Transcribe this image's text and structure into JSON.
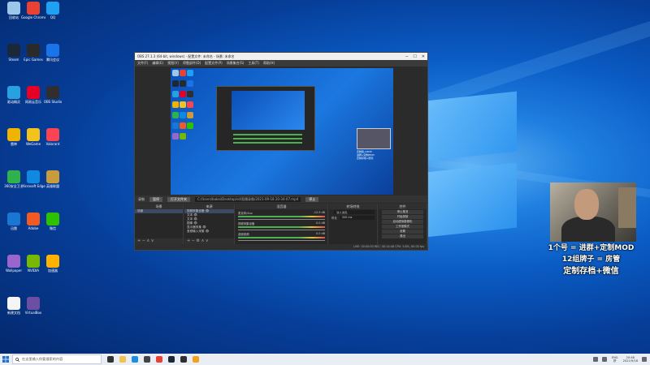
{
  "desktop_icons": [
    {
      "label": "回收站",
      "color": "#9cc7e8"
    },
    {
      "label": "Google Chrome",
      "color": "#e94235"
    },
    {
      "label": "QQ",
      "color": "#1ea1f2"
    },
    {
      "label": "Steam",
      "color": "#1b2838"
    },
    {
      "label": "Epic Games",
      "color": "#2a2a2a"
    },
    {
      "label": "腾讯会议",
      "color": "#1a73e8"
    },
    {
      "label": "驱动精灵",
      "color": "#27a1e0"
    },
    {
      "label": "网易云音乐",
      "color": "#e60026"
    },
    {
      "label": "OBS Studio",
      "color": "#302e31"
    },
    {
      "label": "雷神",
      "color": "#f0b400"
    },
    {
      "label": "WeGame",
      "color": "#f4c21c"
    },
    {
      "label": "Valorant",
      "color": "#fa4454"
    },
    {
      "label": "360安全卫士",
      "color": "#2fb24c"
    },
    {
      "label": "Microsoft Edge",
      "color": "#0f8ae0"
    },
    {
      "label": "英雄联盟",
      "color": "#c89b3c"
    },
    {
      "label": "迅雷",
      "color": "#1976d2"
    },
    {
      "label": "Adobe",
      "color": "#f15a24"
    },
    {
      "label": "微信",
      "color": "#2dc100"
    },
    {
      "label": "Wallpaper",
      "color": "#9966cc"
    },
    {
      "label": "NVIDIA",
      "color": "#76b900"
    },
    {
      "label": "加速器",
      "color": "#ffb300"
    },
    {
      "label": "新建文档",
      "color": "#f5f5f5"
    },
    {
      "label": "VirtualBox",
      "color": "#6c4fa3"
    }
  ],
  "obs": {
    "title": "OBS 27.1.3 (64-bit, windows) - 配置文件: 未命名 - 场景: 未命名",
    "menu": [
      "文件(F)",
      "编辑(E)",
      "视图(V)",
      "停靠部件(D)",
      "配置文件(P)",
      "场景集合(S)",
      "工具(T)",
      "帮助(H)"
    ],
    "recording_label": "录制",
    "pause_label": "暂停",
    "open_folder_label": "打开文件夹",
    "recording_path": "C:/Users/bakai/Desktop/sd/直播录像/2021-09-18 20-34-07.mp4",
    "stop_label": "停止",
    "scenes_header": "场景",
    "scenes": [
      "场景"
    ],
    "sources_header": "来源",
    "sources": [
      "视频采集设备",
      "文本",
      "文本",
      "图像",
      "显示器采集",
      "音频输入采集"
    ],
    "mixer_header": "混音器",
    "mixer_channels": [
      {
        "name": "麦克风/Aux",
        "db": "-12.9 dB"
      },
      {
        "name": "视频采集设备",
        "db": "0.0 dB"
      },
      {
        "name": "桌面音频",
        "db": "0.0 dB"
      }
    ],
    "transitions_header": "转场特效",
    "transition_type": "淡入淡出",
    "duration_label": "时长",
    "duration_value": "300 ms",
    "controls_header": "控件",
    "controls": [
      "停止推流",
      "开始录制",
      "启动虚拟摄像机",
      "工作室模式",
      "设置",
      "退出"
    ],
    "status": "LIVE: 00:00:00   REC: 00:14:46   CPU: 5.8%, 60.00 fps",
    "webcam_caption": "定制版+MOD\n进群+定制MOD\n定制存档+陪玩"
  },
  "overlay": {
    "line1": "1个号 = 进群+定制MOD",
    "line2": "12组牌子 = 房管",
    "line3": "定制存档+微信"
  },
  "taskbar": {
    "search_placeholder": "在这里输入你要搜索的内容",
    "tray_lang": "ENG",
    "tray_ime": "拼",
    "time": "20:48",
    "date": "2021/9/18",
    "apps": [
      {
        "name": "task-view",
        "color": "#333"
      },
      {
        "name": "file-explorer",
        "color": "#f2c14e"
      },
      {
        "name": "edge",
        "color": "#1f8ee0"
      },
      {
        "name": "store",
        "color": "#444"
      },
      {
        "name": "chrome",
        "color": "#e94235"
      },
      {
        "name": "steam",
        "color": "#1b2838"
      },
      {
        "name": "obs",
        "color": "#302e31"
      },
      {
        "name": "wegame",
        "color": "#f4a21c"
      }
    ]
  }
}
